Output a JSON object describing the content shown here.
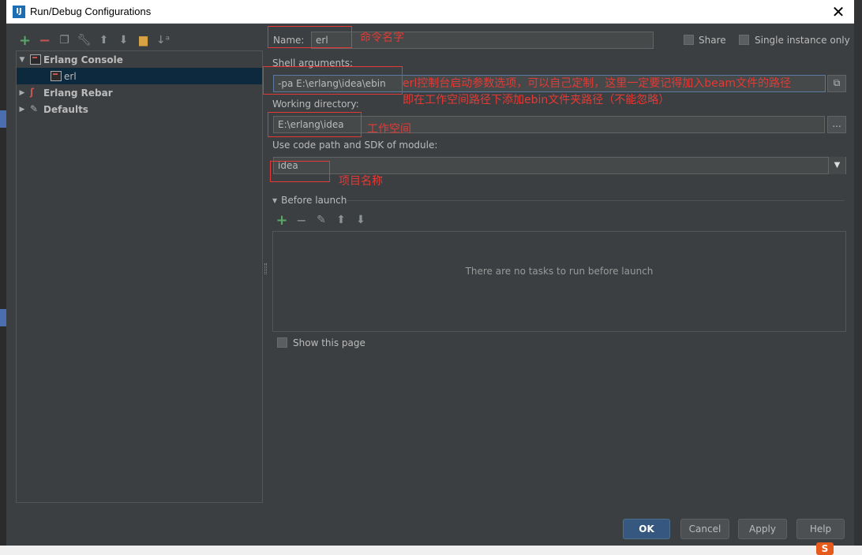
{
  "window": {
    "title": "Run/Debug Configurations"
  },
  "toolbar": {
    "icons": [
      "add-icon",
      "remove-icon",
      "copy-icon",
      "wrench-icon",
      "arrow-up-icon",
      "arrow-down-icon",
      "folder-icon",
      "sort-icon"
    ]
  },
  "tree": {
    "items": [
      {
        "label": "Erlang Console",
        "expanded": true
      },
      {
        "label": "erl",
        "selected": true
      },
      {
        "label": "Erlang Rebar",
        "expanded": false
      },
      {
        "label": "Defaults",
        "expanded": false
      }
    ]
  },
  "form": {
    "name_label": "Name:",
    "name_value": "erl",
    "share_label": "Share",
    "single_instance_label": "Single instance only",
    "shell_args_label": "Shell arguments:",
    "shell_args_value": "-pa E:\\erlang\\idea\\ebin",
    "working_dir_label": "Working directory:",
    "working_dir_value": "E:\\erlang\\idea",
    "browse_label": "...",
    "module_label": "Use code path and SDK of module:",
    "module_value": "idea"
  },
  "before_launch": {
    "title": "Before launch",
    "empty_text": "There are no tasks to run before launch",
    "show_page_label": "Show this page"
  },
  "buttons": {
    "ok": "OK",
    "cancel": "Cancel",
    "apply": "Apply",
    "help": "Help"
  },
  "annotations": {
    "name_note": "命令名字",
    "shell_note_line1": "erl控制台启动参数选项，可以自己定制，这里一定要记得加入beam文件的路径",
    "shell_note_line2": "即在工作空间路径下添加ebin文件夹路径（不能忽略）",
    "working_note": "工作空间",
    "module_note": "项目名称"
  },
  "colors": {
    "annotation": "#e53935",
    "selection": "#0d293e",
    "primary_button": "#365880"
  },
  "footer": {
    "logo": "S"
  }
}
